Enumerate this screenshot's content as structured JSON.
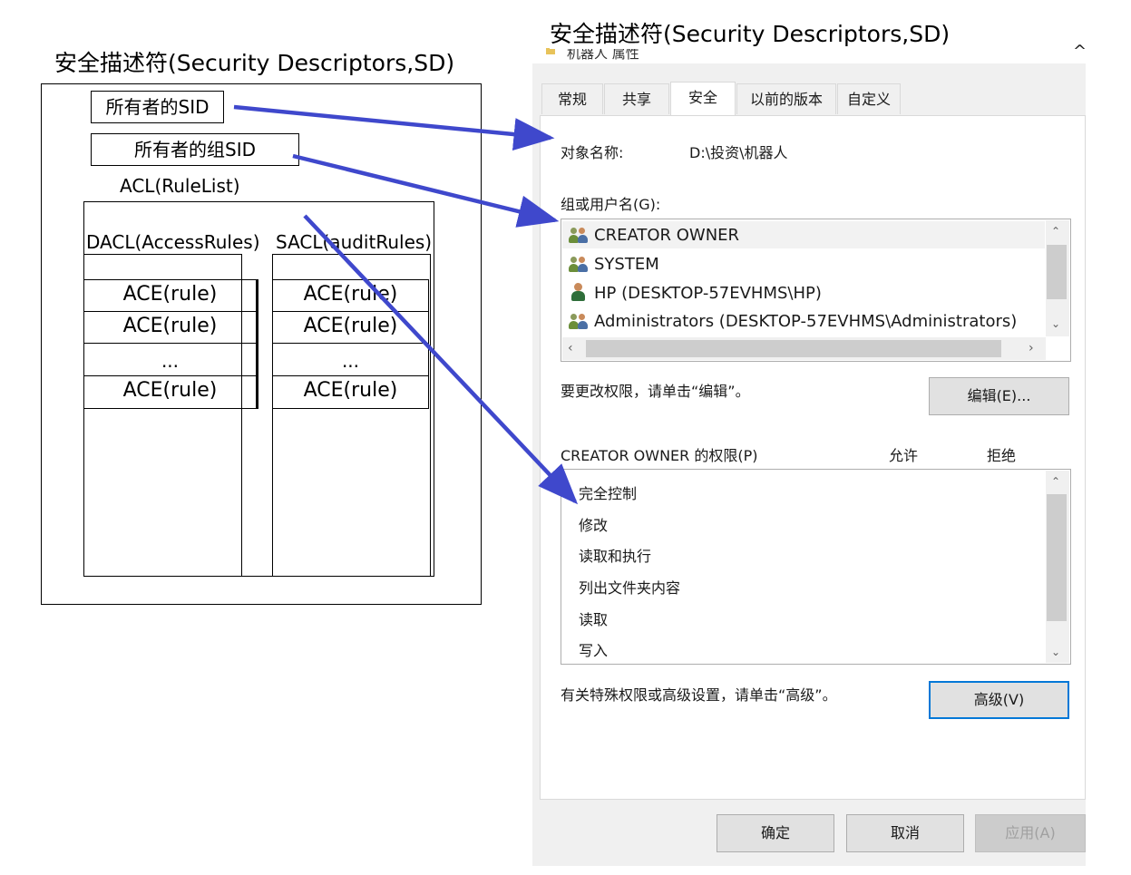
{
  "diagram": {
    "left_caption": "安全描述符(Security Descriptors,SD)",
    "right_caption": "安全描述符(Security Descriptors,SD)",
    "owner_sid": "所有者的SID",
    "group_sid": "所有者的组SID",
    "acl_label": "ACL(RuleList)",
    "dacl_label": "DACL(AccessRules)",
    "sacl_label": "SACL(auditRules)",
    "dacl_rows": [
      "ACE(rule)",
      "ACE(rule)",
      "...",
      "ACE(rule)"
    ],
    "sacl_rows": [
      "ACE(rule)",
      "ACE(rule)",
      "...",
      "ACE(rule)"
    ],
    "arrow_color": "#3f48cc"
  },
  "dialog": {
    "title": "机器人 属性",
    "close_glyph": "^",
    "tabs": [
      "常规",
      "共享",
      "安全",
      "以前的版本",
      "自定义"
    ],
    "active_tab": "安全",
    "object_name_label": "对象名称:",
    "object_name_value": "D:\\投资\\机器人",
    "groups_label": "组或用户名(G):",
    "groups": [
      {
        "name": "CREATOR OWNER",
        "icon": "group-icon",
        "selected": true
      },
      {
        "name": "SYSTEM",
        "icon": "group-icon",
        "selected": false
      },
      {
        "name": "HP (DESKTOP-57EVHMS\\HP)",
        "icon": "user-icon",
        "selected": false
      },
      {
        "name": "Administrators (DESKTOP-57EVHMS\\Administrators)",
        "icon": "group-icon",
        "selected": false
      }
    ],
    "change_hint": "要更改权限，请单击“编辑”。",
    "edit_button": "编辑(E)...",
    "permissions_label": "CREATOR OWNER 的权限(P)",
    "allow_header": "允许",
    "deny_header": "拒绝",
    "permissions": [
      "完全控制",
      "修改",
      "读取和执行",
      "列出文件夹内容",
      "读取",
      "写入"
    ],
    "advanced_hint": "有关特殊权限或高级设置，请单击“高级”。",
    "advanced_button": "高级(V)",
    "ok_button": "确定",
    "cancel_button": "取消",
    "apply_button": "应用(A)"
  }
}
